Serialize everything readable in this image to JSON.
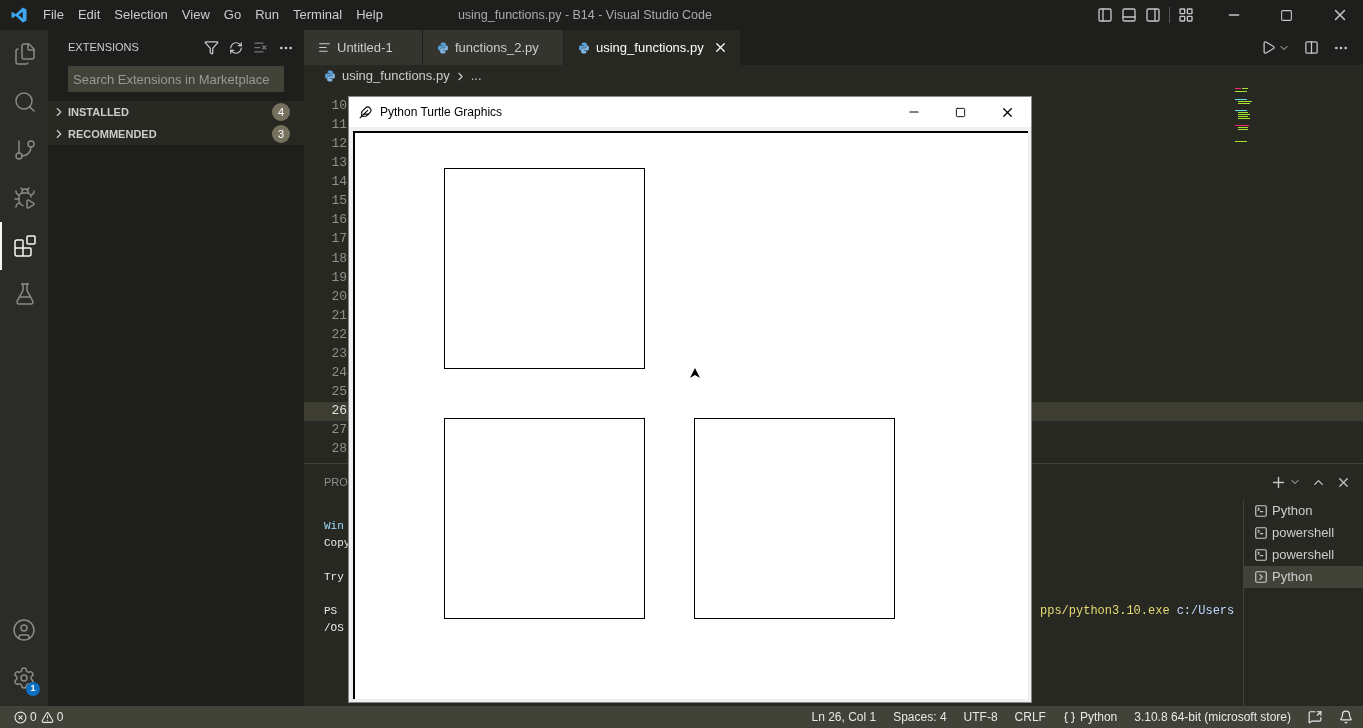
{
  "title_bar": {
    "menu": [
      "File",
      "Edit",
      "Selection",
      "View",
      "Go",
      "Run",
      "Terminal",
      "Help"
    ],
    "title": "using_functions.py - B14 - Visual Studio Code"
  },
  "activity_bar": [
    {
      "kind": "files",
      "selected": false
    },
    {
      "kind": "search",
      "selected": false
    },
    {
      "kind": "source-control",
      "selected": false
    },
    {
      "kind": "run-debug",
      "selected": false
    },
    {
      "kind": "extensions",
      "selected": true
    },
    {
      "kind": "testing",
      "selected": false
    }
  ],
  "activity_bottom": [
    {
      "kind": "account"
    },
    {
      "kind": "settings",
      "badge": "1"
    }
  ],
  "sidebar": {
    "title": "EXTENSIONS",
    "search": {
      "placeholder": "Search Extensions in Marketplace"
    },
    "sections": [
      {
        "label": "INSTALLED",
        "count": "4",
        "expanded": false
      },
      {
        "label": "RECOMMENDED",
        "count": "3",
        "expanded": false
      }
    ]
  },
  "tabs": [
    {
      "label": "Untitled-1",
      "kind": "text",
      "selected": false
    },
    {
      "label": "functions_2.py",
      "kind": "python",
      "selected": false
    },
    {
      "label": "using_functions.py",
      "kind": "python",
      "selected": true
    }
  ],
  "breadcrumb": {
    "file": "using_functions.py",
    "rest": "..."
  },
  "editor": {
    "line_numbers": [
      {
        "number": "10",
        "current": false
      },
      {
        "number": "11",
        "current": false
      },
      {
        "number": "12",
        "current": false
      },
      {
        "number": "13",
        "current": false
      },
      {
        "number": "14",
        "current": false
      },
      {
        "number": "15",
        "current": false
      },
      {
        "number": "16",
        "current": false
      },
      {
        "number": "17",
        "current": false
      },
      {
        "number": "18",
        "current": false
      },
      {
        "number": "19",
        "current": false
      },
      {
        "number": "20",
        "current": false
      },
      {
        "number": "21",
        "current": false
      },
      {
        "number": "22",
        "current": false
      },
      {
        "number": "23",
        "current": false
      },
      {
        "number": "24",
        "current": false
      },
      {
        "number": "25",
        "current": false
      },
      {
        "number": "26",
        "current": true
      },
      {
        "number": "27",
        "current": false
      },
      {
        "number": "28",
        "current": false
      }
    ]
  },
  "panel": {
    "tab": "PRO",
    "terminal_blocks": [
      {
        "lines": [
          {
            "text": "Win",
            "kind": "info"
          },
          {
            "text": "Copy",
            "kind": "plain"
          }
        ]
      },
      {
        "lines": [
          {
            "text": "Try",
            "kind": "plain"
          }
        ]
      },
      {
        "lines": [
          {
            "text": "PS",
            "kind": "plain",
            "tail_program": "pps/python3.10.exe",
            "tail_argument": "c:/Users"
          },
          {
            "text": "/OS",
            "kind": "plain"
          }
        ]
      }
    ],
    "terminals": [
      {
        "label": "Python",
        "kind": "shell",
        "selected": false
      },
      {
        "label": "powershell",
        "kind": "shell",
        "selected": false
      },
      {
        "label": "powershell",
        "kind": "shell",
        "selected": false
      },
      {
        "label": "Python",
        "kind": "task",
        "selected": true
      }
    ]
  },
  "turtle_window": {
    "title": "Python Turtle Graphics"
  },
  "status_bar": {
    "errors": "0",
    "warnings": "0",
    "position": "Ln 26, Col 1",
    "spaces": "Spaces: 4",
    "encoding": "UTF-8",
    "eol": "CRLF",
    "language": "Python",
    "interpreter": "3.10.8 64-bit (microsoft store)"
  }
}
